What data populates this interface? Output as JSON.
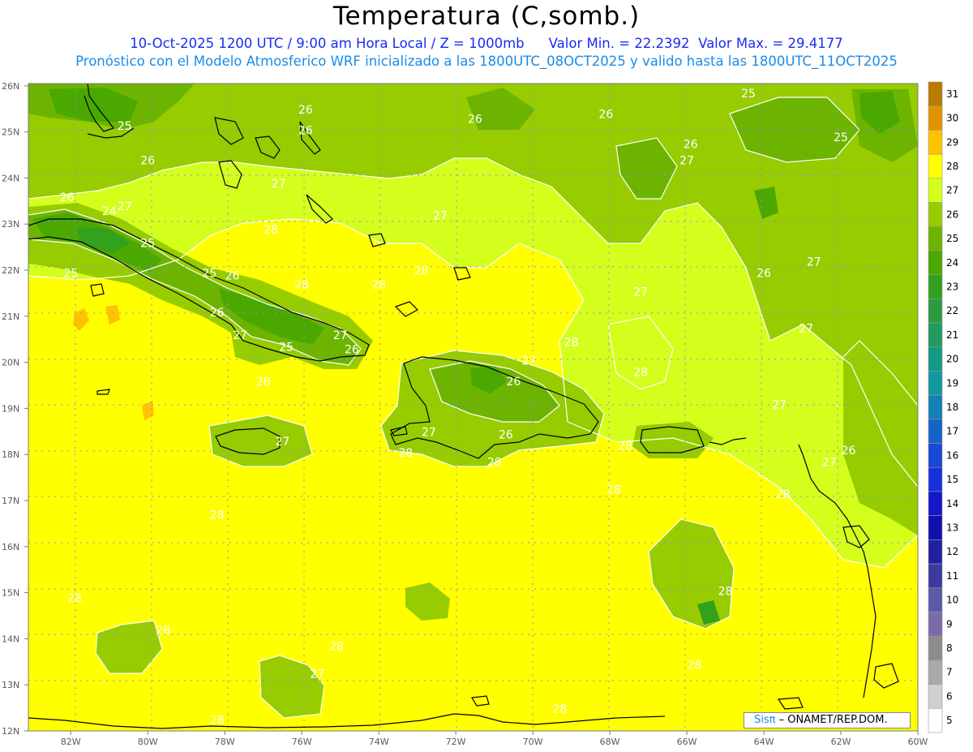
{
  "title": "Temperatura (C,somb.)",
  "subtitle": {
    "date_time": "10-Oct-2025  1200 UTC / 9:00 am Hora Local / Z = 1000mb",
    "min_label": "Valor Min. = 22.2392",
    "max_label": "Valor Max. = 29.4177"
  },
  "forecast_line": "Pronóstico con el Modelo Atmosferico WRF inicializado a las 1800UTC_08OCT2025 y valido hasta las  1800UTC_11OCT2025",
  "credit": {
    "brand": "Sisπ",
    "separator": " – ",
    "org": "ONAMET/REP.DOM."
  },
  "map": {
    "region": "Caribbean",
    "lat_ticks": [
      "26N",
      "25N",
      "24N",
      "23N",
      "22N",
      "21N",
      "20N",
      "19N",
      "18N",
      "17N",
      "16N",
      "15N",
      "14N",
      "13N",
      "12N"
    ],
    "lon_ticks": [
      "82W",
      "80W",
      "78W",
      "76W",
      "74W",
      "72W",
      "70W",
      "68W",
      "66W",
      "64W",
      "62W",
      "60W"
    ],
    "contour_labels": [
      {
        "text": "25",
        "lon": -80.6,
        "lat": 25.05
      },
      {
        "text": "26",
        "lon": -80.0,
        "lat": 24.3
      },
      {
        "text": "26",
        "lon": -82.1,
        "lat": 23.5
      },
      {
        "text": "24",
        "lon": -81.0,
        "lat": 23.2
      },
      {
        "text": "27",
        "lon": -80.6,
        "lat": 23.3
      },
      {
        "text": "25",
        "lon": -80.0,
        "lat": 22.5
      },
      {
        "text": "25",
        "lon": -82.0,
        "lat": 21.85
      },
      {
        "text": "25",
        "lon": -78.4,
        "lat": 21.85
      },
      {
        "text": "26",
        "lon": -77.8,
        "lat": 21.8
      },
      {
        "text": "26",
        "lon": -78.2,
        "lat": 21.0
      },
      {
        "text": "26",
        "lon": -75.9,
        "lat": 25.4
      },
      {
        "text": "26",
        "lon": -75.9,
        "lat": 24.95
      },
      {
        "text": "27",
        "lon": -76.6,
        "lat": 23.8
      },
      {
        "text": "28",
        "lon": -76.8,
        "lat": 22.8
      },
      {
        "text": "28",
        "lon": -76.0,
        "lat": 21.6
      },
      {
        "text": "27",
        "lon": -77.6,
        "lat": 20.5
      },
      {
        "text": "25",
        "lon": -76.4,
        "lat": 20.25
      },
      {
        "text": "27",
        "lon": -75.0,
        "lat": 20.5
      },
      {
        "text": "26",
        "lon": -74.7,
        "lat": 20.2
      },
      {
        "text": "28",
        "lon": -77.0,
        "lat": 19.5
      },
      {
        "text": "28",
        "lon": -74.0,
        "lat": 21.6
      },
      {
        "text": "28",
        "lon": -72.9,
        "lat": 21.9
      },
      {
        "text": "27",
        "lon": -72.4,
        "lat": 23.1
      },
      {
        "text": "26",
        "lon": -71.5,
        "lat": 25.2
      },
      {
        "text": "26",
        "lon": -68.1,
        "lat": 25.3
      },
      {
        "text": "27",
        "lon": -66.0,
        "lat": 24.3
      },
      {
        "text": "26",
        "lon": -65.9,
        "lat": 24.65
      },
      {
        "text": "25",
        "lon": -64.4,
        "lat": 25.75
      },
      {
        "text": "25",
        "lon": -62.0,
        "lat": 24.8
      },
      {
        "text": "27",
        "lon": -62.7,
        "lat": 22.1
      },
      {
        "text": "26",
        "lon": -64.0,
        "lat": 21.85
      },
      {
        "text": "27",
        "lon": -67.2,
        "lat": 21.45
      },
      {
        "text": "27",
        "lon": -62.9,
        "lat": 20.65
      },
      {
        "text": "27",
        "lon": -63.6,
        "lat": 19.0
      },
      {
        "text": "26",
        "lon": -61.8,
        "lat": 18.0
      },
      {
        "text": "27",
        "lon": -62.3,
        "lat": 17.75
      },
      {
        "text": "28",
        "lon": -63.5,
        "lat": 17.05
      },
      {
        "text": "28",
        "lon": -69.0,
        "lat": 20.35
      },
      {
        "text": "28",
        "lon": -67.2,
        "lat": 19.7
      },
      {
        "text": "27",
        "lon": -70.1,
        "lat": 19.95
      },
      {
        "text": "26",
        "lon": -70.5,
        "lat": 19.5
      },
      {
        "text": "26",
        "lon": -70.7,
        "lat": 18.35
      },
      {
        "text": "27",
        "lon": -72.7,
        "lat": 18.4
      },
      {
        "text": "28",
        "lon": -73.3,
        "lat": 17.95
      },
      {
        "text": "28",
        "lon": -71.0,
        "lat": 17.75
      },
      {
        "text": "28",
        "lon": -67.6,
        "lat": 18.1
      },
      {
        "text": "28",
        "lon": -67.9,
        "lat": 17.15
      },
      {
        "text": "27",
        "lon": -76.5,
        "lat": 18.2
      },
      {
        "text": "28",
        "lon": -78.2,
        "lat": 16.6
      },
      {
        "text": "28",
        "lon": -81.9,
        "lat": 14.8
      },
      {
        "text": "28",
        "lon": -79.6,
        "lat": 14.1
      },
      {
        "text": "28",
        "lon": -75.1,
        "lat": 13.75
      },
      {
        "text": "27",
        "lon": -75.6,
        "lat": 13.15
      },
      {
        "text": "28",
        "lon": -78.2,
        "lat": 12.15
      },
      {
        "text": "28",
        "lon": -69.3,
        "lat": 12.4
      },
      {
        "text": "28",
        "lon": -65.0,
        "lat": 14.95
      },
      {
        "text": "28",
        "lon": -65.8,
        "lat": 13.35
      }
    ]
  },
  "colorbar": {
    "levels": [
      "31",
      "30",
      "29",
      "28",
      "27",
      "26",
      "25",
      "24",
      "23",
      "22",
      "21",
      "20",
      "19",
      "18",
      "17",
      "16",
      "15",
      "14",
      "13",
      "12",
      "11",
      "10",
      "9",
      "8",
      "7",
      "6",
      "5"
    ],
    "colors": [
      "#b87a00",
      "#e09400",
      "#ffc200",
      "#ffff00",
      "#d4ff1c",
      "#96cc00",
      "#6cb400",
      "#4aa800",
      "#33a01e",
      "#2d9a40",
      "#209a60",
      "#129a84",
      "#109aa0",
      "#1280b4",
      "#1464c8",
      "#1848d4",
      "#1830dc",
      "#1418c8",
      "#1010b0",
      "#2020a0",
      "#3a3aa0",
      "#5a5aa8",
      "#7a6aa8",
      "#8c8c8c",
      "#aaaaaa",
      "#d0d0d0",
      "#ffffff"
    ]
  },
  "colors": {
    "title": "#000000",
    "subtitle": "#1a2cf0",
    "forecast_line": "#1a8ce8",
    "t_27": "#d4ff1c",
    "t_28": "#ffff00",
    "t_26": "#96cc00",
    "t_25": "#6cb400",
    "t_24": "#4aa800",
    "t_23": "#33a01e",
    "t_29": "#ffc200",
    "coast": "#000000",
    "contour": "#ffffff"
  }
}
